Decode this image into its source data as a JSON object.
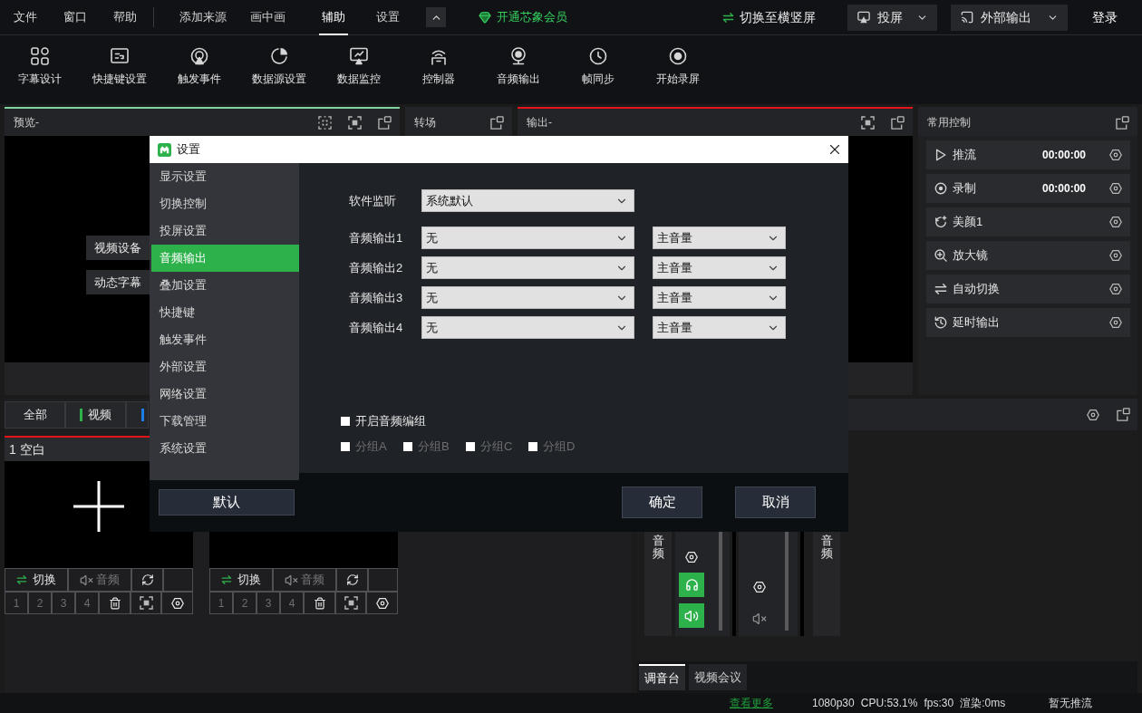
{
  "menu_bar": {
    "menus": [
      "文件",
      "窗口",
      "帮助"
    ],
    "tabs": [
      {
        "label": "添加来源",
        "selected": false
      },
      {
        "label": "画中画",
        "selected": false
      },
      {
        "label": "辅助",
        "selected": true
      },
      {
        "label": "设置",
        "selected": false
      }
    ],
    "membership_link": "开通芯象会员",
    "orientation_button": "切换至横竖屏",
    "cast_dropdown": "投屏",
    "output_dropdown": "外部输出",
    "login_button": "登录"
  },
  "toolbar": [
    "字幕设计",
    "快捷键设置",
    "触发事件",
    "数据源设置",
    "数据监控",
    "控制器",
    "音频输出",
    "帧同步",
    "开始录屏"
  ],
  "preview_panel": {
    "title": "预览-",
    "buttons": [
      "视频设备",
      "动态字幕"
    ]
  },
  "transition_panel": {
    "title": "转场"
  },
  "output_panel": {
    "title": "输出-"
  },
  "common_controls": {
    "title": "常用控制",
    "items": [
      {
        "label": "推流",
        "time": "00:00:00"
      },
      {
        "label": "录制",
        "time": "00:00:00"
      },
      {
        "label": "美颜1"
      },
      {
        "label": "放大镜"
      },
      {
        "label": "自动切换"
      },
      {
        "label": "延时输出"
      }
    ]
  },
  "sources": {
    "tabs": [
      {
        "label": "全部"
      },
      {
        "label": "视频",
        "color": "#2db24b"
      },
      {
        "color": "#1a7fe8"
      }
    ],
    "cards": [
      {
        "title": "1 空白",
        "selected": true,
        "empty": true,
        "switch_button": "切换",
        "audio_button": {
          "label": "音频",
          "muted": true
        },
        "slots": [
          {
            "label": "1",
            "disabled": true
          },
          {
            "label": "2",
            "disabled": true
          },
          {
            "label": "3",
            "disabled": true
          },
          {
            "label": "4",
            "disabled": true
          }
        ]
      },
      {
        "switch_button": "切换",
        "audio_button": {
          "label": "音频",
          "muted": true
        },
        "slots": [
          {
            "label": "1",
            "disabled": true
          },
          {
            "label": "2",
            "disabled": true
          },
          {
            "label": "3",
            "disabled": true
          },
          {
            "label": "4",
            "disabled": true
          }
        ]
      }
    ]
  },
  "mixer": {
    "strips": [
      {
        "kind": "label",
        "label": "音频"
      },
      {
        "kind": "channel",
        "monitor": true,
        "muted": false
      },
      {
        "kind": "channel",
        "monitor": false,
        "muted": true
      },
      {
        "kind": "label",
        "label": "音频"
      }
    ],
    "tabs": [
      {
        "label": "调音台",
        "selected": true
      },
      {
        "label": "视频会议",
        "selected": false
      }
    ]
  },
  "status_bar": {
    "link": "查看更多",
    "stats": [
      "1080p30",
      "CPU:53.1%",
      "fps:30",
      "渲染:0ms"
    ],
    "stream_status": "暂无推流"
  },
  "settings_dialog": {
    "title": "设置",
    "nav": [
      {
        "label": "显示设置",
        "selected": false
      },
      {
        "label": "切换控制",
        "selected": false
      },
      {
        "label": "投屏设置",
        "selected": false
      },
      {
        "label": "音频输出",
        "selected": true
      },
      {
        "label": "叠加设置",
        "selected": false
      },
      {
        "label": "快捷键",
        "selected": false
      },
      {
        "label": "触发事件",
        "selected": false
      },
      {
        "label": "外部设置",
        "selected": false
      },
      {
        "label": "网络设置",
        "selected": false
      },
      {
        "label": "下载管理",
        "selected": false
      },
      {
        "label": "系统设置",
        "selected": false
      }
    ],
    "monitor": {
      "label": "软件监听",
      "value": "系统默认"
    },
    "outputs": [
      {
        "label": "音频输出1",
        "device": "无",
        "volume": "主音量"
      },
      {
        "label": "音频输出2",
        "device": "无",
        "volume": "主音量"
      },
      {
        "label": "音频输出3",
        "device": "无",
        "volume": "主音量"
      },
      {
        "label": "音频输出4",
        "device": "无",
        "volume": "主音量"
      }
    ],
    "grouping": {
      "label": "开启音频编组",
      "checked": false
    },
    "groups": [
      {
        "label": "分组A",
        "checked": false,
        "disabled": true
      },
      {
        "label": "分组B",
        "checked": false,
        "disabled": true
      },
      {
        "label": "分组C",
        "checked": false,
        "disabled": true
      },
      {
        "label": "分组D",
        "checked": false,
        "disabled": true
      }
    ],
    "buttons": {
      "default": "默认",
      "ok": "确定",
      "cancel": "取消"
    }
  }
}
